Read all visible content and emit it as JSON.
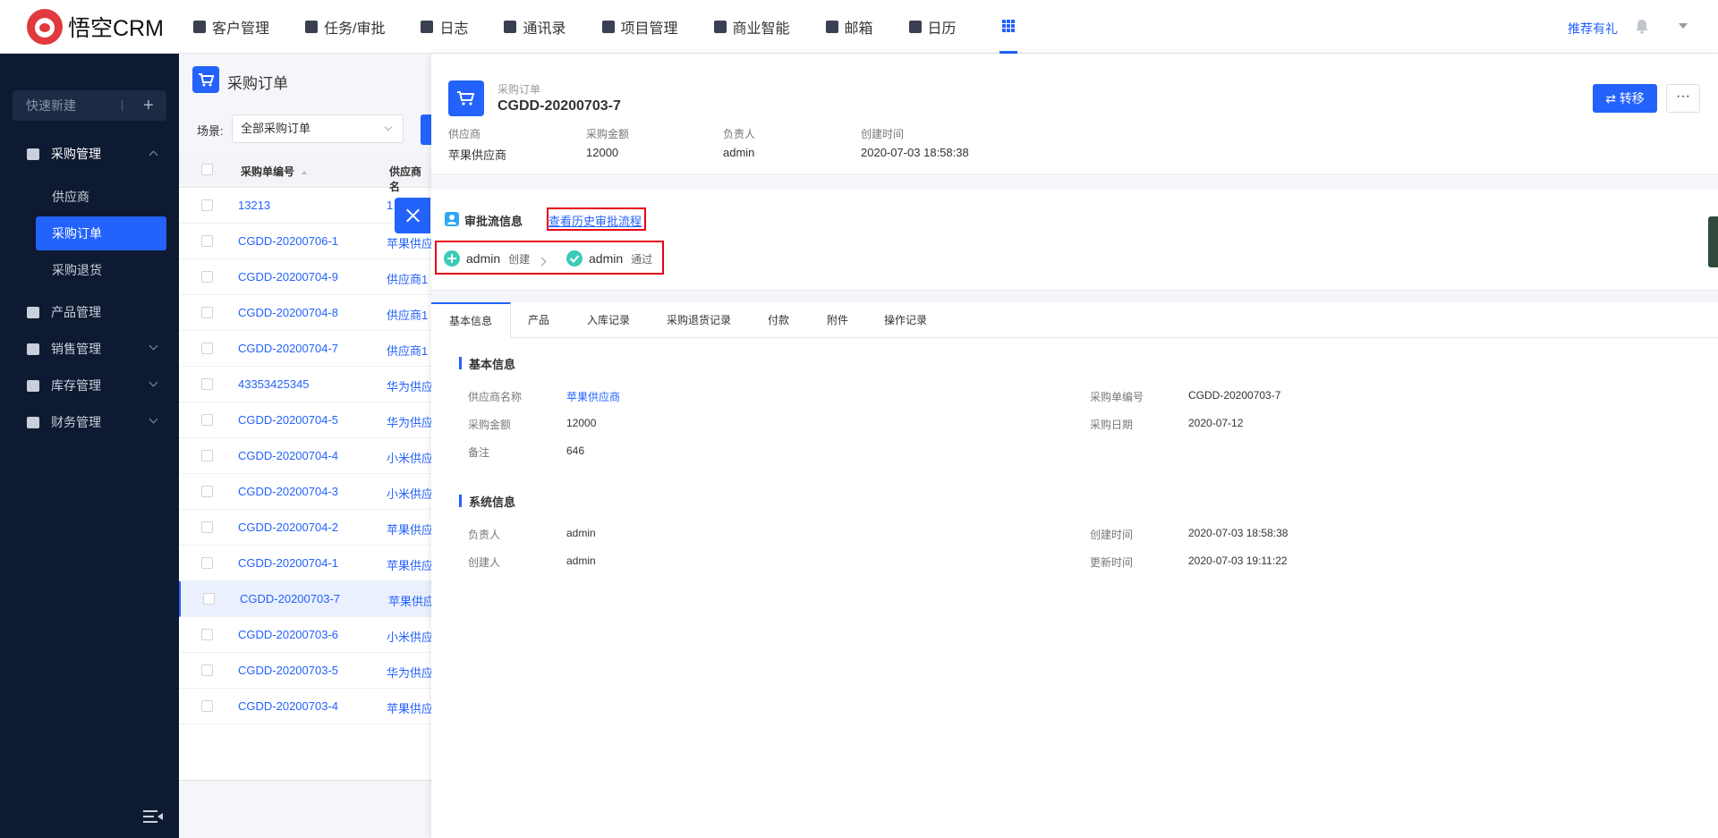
{
  "app": {
    "logo_text": "悟空CRM"
  },
  "nav": {
    "items": [
      {
        "label": "客户管理",
        "icon": "customer-icon"
      },
      {
        "label": "任务/审批",
        "icon": "briefcase-icon"
      },
      {
        "label": "日志",
        "icon": "log-icon"
      },
      {
        "label": "通讯录",
        "icon": "contacts-icon"
      },
      {
        "label": "项目管理",
        "icon": "project-icon"
      },
      {
        "label": "商业智能",
        "icon": "bi-icon"
      },
      {
        "label": "邮箱",
        "icon": "mail-icon"
      },
      {
        "label": "日历",
        "icon": "calendar-icon"
      }
    ],
    "recommend": "推荐有礼"
  },
  "sidebar": {
    "quick_create": "快速新建",
    "groups": [
      {
        "label": "采购管理",
        "sub": [
          "供应商",
          "采购订单",
          "采购退货"
        ],
        "active_sub": "采购订单"
      },
      {
        "label": "产品管理"
      },
      {
        "label": "销售管理"
      },
      {
        "label": "库存管理"
      },
      {
        "label": "财务管理"
      }
    ]
  },
  "list": {
    "title": "采购订单",
    "scene_label": "场景:",
    "scene_value": "全部采购订单",
    "columns": [
      "采购单编号",
      "供应商名"
    ],
    "rows": [
      {
        "code": "13213",
        "supplier": "1"
      },
      {
        "code": "CGDD-20200706-1",
        "supplier": "苹果供应"
      },
      {
        "code": "CGDD-20200704-9",
        "supplier": "供应商1"
      },
      {
        "code": "CGDD-20200704-8",
        "supplier": "供应商1"
      },
      {
        "code": "CGDD-20200704-7",
        "supplier": "供应商1"
      },
      {
        "code": "43353425345",
        "supplier": "华为供应"
      },
      {
        "code": "CGDD-20200704-5",
        "supplier": "华为供应"
      },
      {
        "code": "CGDD-20200704-4",
        "supplier": "小米供应"
      },
      {
        "code": "CGDD-20200704-3",
        "supplier": "小米供应"
      },
      {
        "code": "CGDD-20200704-2",
        "supplier": "苹果供应"
      },
      {
        "code": "CGDD-20200704-1",
        "supplier": "苹果供应"
      },
      {
        "code": "CGDD-20200703-7",
        "supplier": "苹果供应"
      },
      {
        "code": "CGDD-20200703-6",
        "supplier": "小米供应"
      },
      {
        "code": "CGDD-20200703-5",
        "supplier": "华为供应"
      },
      {
        "code": "CGDD-20200703-4",
        "supplier": "苹果供应"
      }
    ],
    "selected_code": "CGDD-20200703-7"
  },
  "detail": {
    "subtitle": "采购订单",
    "title": "CGDD-20200703-7",
    "summary": [
      {
        "label": "供应商",
        "value": "苹果供应商"
      },
      {
        "label": "采购金额",
        "value": "12000"
      },
      {
        "label": "负责人",
        "value": "admin"
      },
      {
        "label": "创建时间",
        "value": "2020-07-03 18:58:38"
      }
    ],
    "transfer_label": "转移",
    "more_label": "···",
    "approval": {
      "title": "审批流信息",
      "history_link": "查看历史审批流程",
      "steps": [
        {
          "user": "admin",
          "action": "创建"
        },
        {
          "user": "admin",
          "action": "通过"
        }
      ]
    },
    "tabs": [
      "基本信息",
      "产品",
      "入库记录",
      "采购退货记录",
      "付款",
      "附件",
      "操作记录"
    ],
    "basic": {
      "title": "基本信息",
      "fields": [
        {
          "label": "供应商名称",
          "value": "苹果供应商"
        },
        {
          "label": "采购单编号",
          "value": "CGDD-20200703-7"
        },
        {
          "label": "采购金额",
          "value": "12000"
        },
        {
          "label": "采购日期",
          "value": "2020-07-12"
        },
        {
          "label": "备注",
          "value": "646"
        }
      ]
    },
    "system": {
      "title": "系统信息",
      "fields": [
        {
          "label": "负责人",
          "value": "admin"
        },
        {
          "label": "创建时间",
          "value": "2020-07-03 18:58:38"
        },
        {
          "label": "创建人",
          "value": "admin"
        },
        {
          "label": "更新时间",
          "value": "2020-07-03 19:11:22"
        }
      ]
    }
  },
  "colors": {
    "accent": "#2362fb",
    "sidebar_bg": "#0e1a31",
    "highlight": "#e60012",
    "approval_icon": "#2ea7f4",
    "flow_green": "#3ccbb8"
  }
}
